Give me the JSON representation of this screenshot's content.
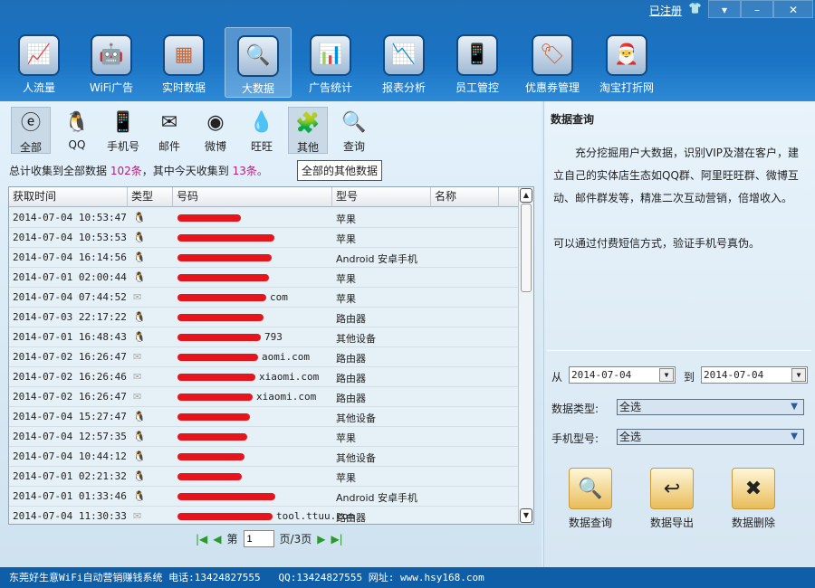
{
  "titlebar": {
    "registered": "已注册"
  },
  "nav": [
    {
      "label": "人流量",
      "icon": "chart-people-icon"
    },
    {
      "label": "WiFi广告",
      "icon": "android-icon"
    },
    {
      "label": "实时数据",
      "icon": "table-icon"
    },
    {
      "label": "大数据",
      "icon": "magnifier-table-icon",
      "selected": true
    },
    {
      "label": "广告统计",
      "icon": "line-chart-icon"
    },
    {
      "label": "报表分析",
      "icon": "report-chart-icon"
    },
    {
      "label": "员工管控",
      "icon": "phone-icon"
    },
    {
      "label": "优惠券管理",
      "icon": "coupon-icon"
    },
    {
      "label": "淘宝打折网",
      "icon": "sale-icon"
    }
  ],
  "sources": [
    {
      "label": "全部",
      "icon": "all-icon",
      "selected": true
    },
    {
      "label": "QQ",
      "icon": "qq-penguin-icon"
    },
    {
      "label": "手机号",
      "icon": "mobile-phone-icon"
    },
    {
      "label": "邮件",
      "icon": "mail-icon"
    },
    {
      "label": "微博",
      "icon": "weibo-icon"
    },
    {
      "label": "旺旺",
      "icon": "wangwang-icon"
    },
    {
      "label": "其他",
      "icon": "puzzle-icon",
      "selected": true
    },
    {
      "label": "查询",
      "icon": "search-folder-icon"
    }
  ],
  "summary": {
    "prefix": "总计收集到全部数据",
    "total": "102条",
    "middle": "，其中今天收集到",
    "today": "13条。"
  },
  "tooltip": "全部的其他数据",
  "table": {
    "headers": [
      "获取时间",
      "类型",
      "号码",
      "型号",
      "名称"
    ],
    "rows": [
      {
        "time": "2014-07-04 10:53:47",
        "type": "qq",
        "number": "",
        "model": "苹果"
      },
      {
        "time": "2014-07-04 10:53:53",
        "type": "qq",
        "number": "",
        "model": "苹果"
      },
      {
        "time": "2014-07-04 16:14:56",
        "type": "qq",
        "number": "",
        "model": "Android 安卓手机"
      },
      {
        "time": "2014-07-01 02:00:44",
        "type": "qq",
        "number": "",
        "model": "苹果"
      },
      {
        "time": "2014-07-04 07:44:52",
        "type": "mail",
        "number": "com",
        "model": "苹果"
      },
      {
        "time": "2014-07-03 22:17:22",
        "type": "qq",
        "number": "",
        "model": "路由器"
      },
      {
        "time": "2014-07-01 16:48:43",
        "type": "qq",
        "number": "793",
        "model": "其他设备"
      },
      {
        "time": "2014-07-02 16:26:47",
        "type": "mail",
        "number": "aomi.com",
        "model": "路由器"
      },
      {
        "time": "2014-07-02 16:26:46",
        "type": "mail",
        "number": "xiaomi.com",
        "model": "路由器"
      },
      {
        "time": "2014-07-02 16:26:47",
        "type": "mail",
        "number": "xiaomi.com",
        "model": "路由器"
      },
      {
        "time": "2014-07-04 15:27:47",
        "type": "qq",
        "number": "",
        "model": "其他设备"
      },
      {
        "time": "2014-07-04 12:57:35",
        "type": "qq",
        "number": "",
        "model": "苹果"
      },
      {
        "time": "2014-07-04 10:44:12",
        "type": "qq",
        "number": "",
        "model": "其他设备"
      },
      {
        "time": "2014-07-01 02:21:32",
        "type": "qq",
        "number": "",
        "model": "苹果"
      },
      {
        "time": "2014-07-01 01:33:46",
        "type": "qq",
        "number": "",
        "model": "Android 安卓手机"
      },
      {
        "time": "2014-07-04 11:30:33",
        "type": "mail",
        "number": "tool.ttuu.com",
        "model": "路由器"
      }
    ]
  },
  "pager": {
    "prefix": "第",
    "page": "1",
    "suffix": "页/3页"
  },
  "panel": {
    "title": "数据查询",
    "lines": [
      "充分挖掘用户大数据，识别VIP及潜在客户，建",
      "立自己的实体店生态如QQ群、阿里旺旺群、微博互",
      "动、邮件群发等，精准二次互动营销，倍增收入。"
    ],
    "note": "可以通过付费短信方式，验证手机号真伪。",
    "from_label": "从",
    "from": "2014-07-04",
    "to_label": "到",
    "to": "2014-07-04",
    "type_label": "数据类型:",
    "type_value": "全选",
    "model_label": "手机型号:",
    "model_value": "全选",
    "actions": [
      {
        "label": "数据查询",
        "icon": "folder-search-icon"
      },
      {
        "label": "数据导出",
        "icon": "folder-export-icon"
      },
      {
        "label": "数据删除",
        "icon": "folder-delete-icon"
      }
    ]
  },
  "footer": "东莞好生意WiFi自动营销赚钱系统 电话:13424827555   QQ:13424827555 网址: www.hsy168.com",
  "colors": {
    "accent": "#1a73c4",
    "highlight": "#b0207a",
    "redaction": "#e8141c"
  }
}
